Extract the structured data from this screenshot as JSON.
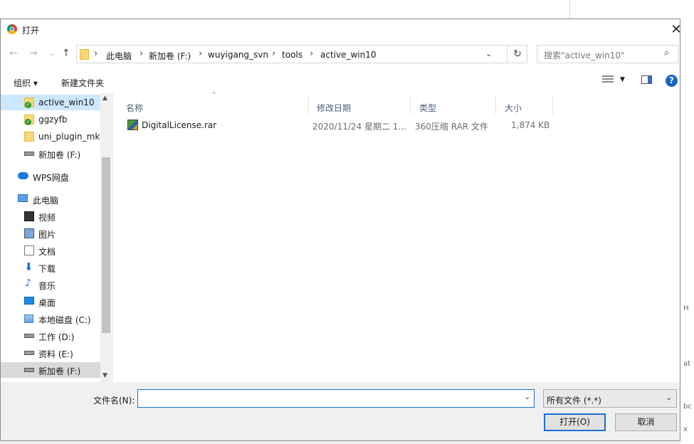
{
  "background": {
    "right_glyphs": [
      "H",
      "at",
      "bc",
      "x"
    ]
  },
  "dialog": {
    "title": "打开"
  },
  "nav": {
    "breadcrumbs": [
      "此电脑",
      "新加卷 (F:)",
      "wuyigang_svn",
      "tools",
      "active_win10"
    ],
    "search_placeholder": "搜索\"active_win10\""
  },
  "toolbar": {
    "organize": "组织 ▾",
    "new_folder": "新建文件夹"
  },
  "sidebar": {
    "items": [
      {
        "label": "active_win10",
        "icon": "folder-synced-icon"
      },
      {
        "label": "ggzyfb",
        "icon": "folder-synced-icon"
      },
      {
        "label": "uni_plugin_mkt",
        "icon": "folder-icon"
      },
      {
        "label": "新加卷 (F:)",
        "icon": "drive-icon"
      },
      {
        "label": "WPS网盘",
        "icon": "cloud-icon"
      },
      {
        "label": "此电脑",
        "icon": "computer-icon"
      },
      {
        "label": "视频",
        "icon": "video-icon"
      },
      {
        "label": "图片",
        "icon": "pictures-icon"
      },
      {
        "label": "文档",
        "icon": "documents-icon"
      },
      {
        "label": "下载",
        "icon": "download-icon"
      },
      {
        "label": "音乐",
        "icon": "music-icon"
      },
      {
        "label": "桌面",
        "icon": "desktop-icon"
      },
      {
        "label": "本地磁盘 (C:)",
        "icon": "windows-drive-icon"
      },
      {
        "label": "工作 (D:)",
        "icon": "drive-icon"
      },
      {
        "label": "资料 (E:)",
        "icon": "drive-icon"
      },
      {
        "label": "新加卷 (F:)",
        "icon": "drive-icon"
      }
    ]
  },
  "files": {
    "columns": [
      "名称",
      "修改日期",
      "类型",
      "大小"
    ],
    "rows": [
      {
        "name": "DigitalLicense.rar",
        "date": "2020/11/24 星期二 1...",
        "type": "360压缩 RAR 文件",
        "size": "1,874 KB"
      }
    ]
  },
  "footer": {
    "filename_label": "文件名(N):",
    "filename_value": "",
    "filetype": "所有文件 (*.*)",
    "open_button": "打开(O)",
    "cancel_button": "取消"
  },
  "colors": {
    "accent": "#1a6fd0",
    "selection": "#cce8ff"
  }
}
